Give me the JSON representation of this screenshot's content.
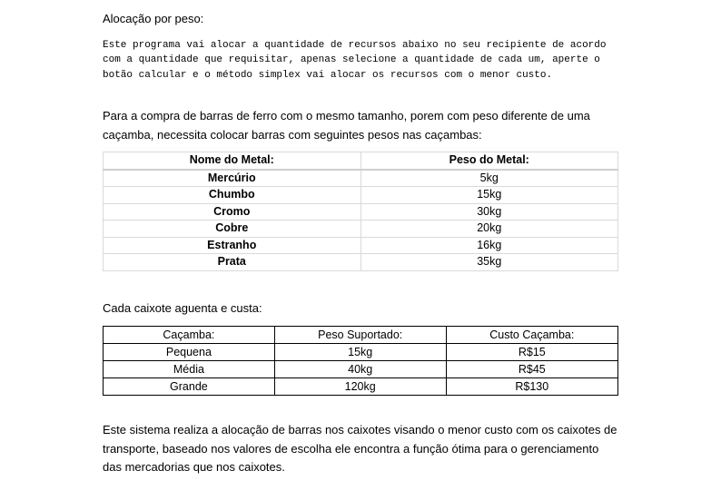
{
  "heading": "Alocação por peso:",
  "intro_mono": "Este programa vai alocar a quantidade de recursos abaixo no seu recipiente de acordo com a quantidade que requisitar, apenas selecione a quantidade de cada um, aperte o botão calcular e o método simplex vai alocar os recursos com o menor custo.",
  "paragraph1": "Para a compra de barras de ferro com o mesmo tamanho, porem com peso diferente de uma caçamba, necessita colocar barras com seguintes pesos nas caçambas:",
  "metal_table": {
    "headers": [
      "Nome do Metal:",
      "Peso do Metal:"
    ],
    "rows": [
      [
        "Mercúrio",
        "5kg"
      ],
      [
        "Chumbo",
        "15kg"
      ],
      [
        "Cromo",
        "30kg"
      ],
      [
        "Cobre",
        "20kg"
      ],
      [
        "Estranho",
        "16kg"
      ],
      [
        "Prata",
        "35kg"
      ]
    ]
  },
  "paragraph2": "Cada caixote aguenta e custa:",
  "cacamba_table": {
    "headers": [
      "Caçamba:",
      "Peso Suportado:",
      "Custo Caçamba:"
    ],
    "rows": [
      [
        "Pequena",
        "15kg",
        "R$15"
      ],
      [
        "Média",
        "40kg",
        "R$45"
      ],
      [
        "Grande",
        "120kg",
        "R$130"
      ]
    ]
  },
  "paragraph3": "Este sistema realiza a alocação de barras nos caixotes visando o menor custo com os caixotes de transporte, baseado nos valores de escolha ele encontra a função ótima para o gerenciamento das mercadorias que nos caixotes."
}
